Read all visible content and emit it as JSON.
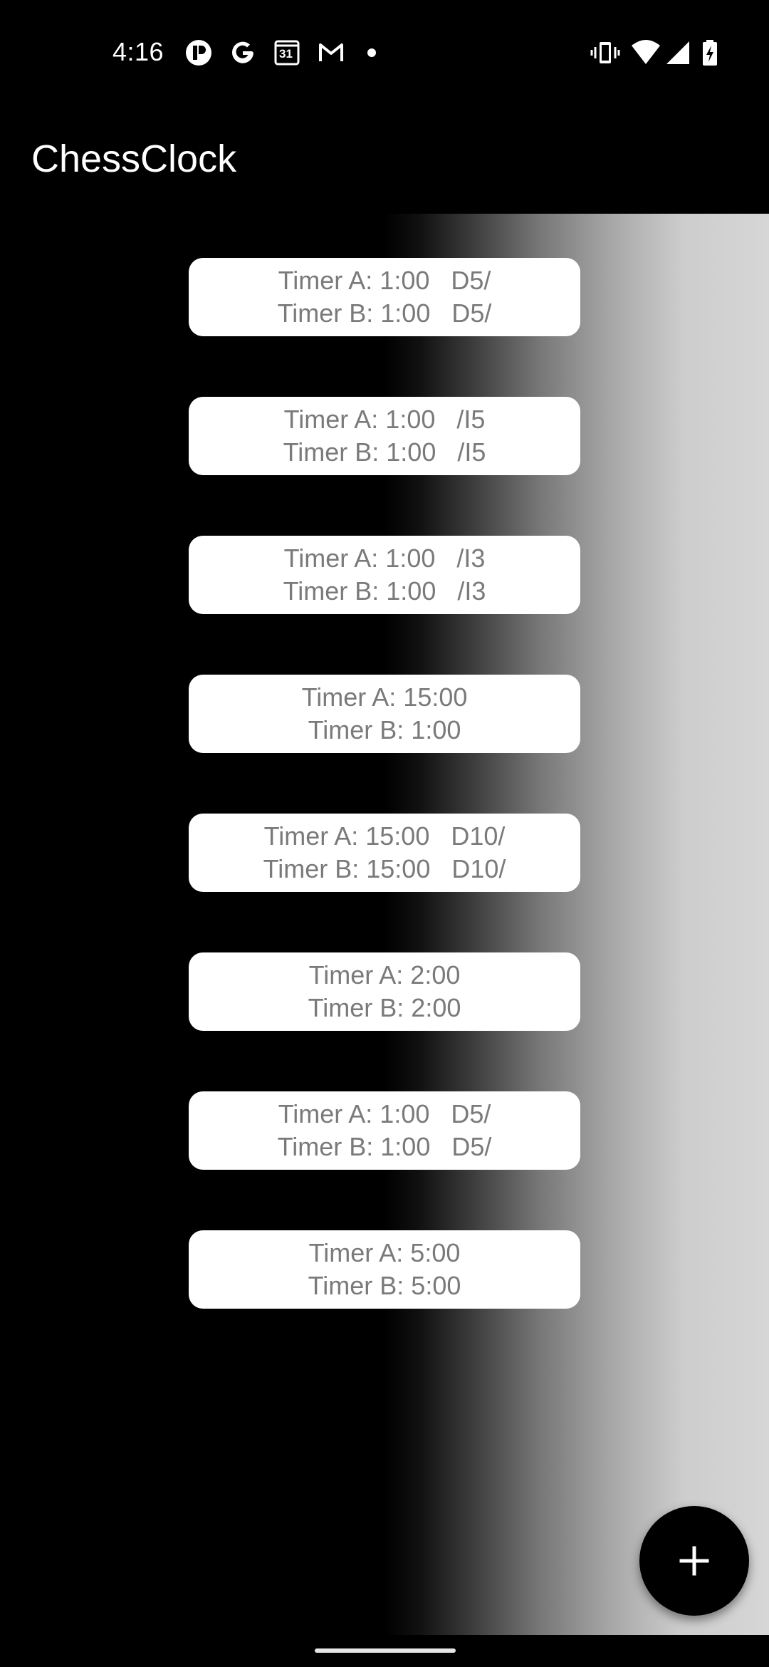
{
  "status_bar": {
    "time": "4:16",
    "calendar_day": "31",
    "left_icons": [
      "app-notification-icon",
      "google-icon",
      "calendar-icon",
      "gmail-icon",
      "dot-icon"
    ],
    "right_icons": [
      "vibrate-icon",
      "wifi-icon",
      "cellular-signal-icon",
      "battery-charging-icon"
    ]
  },
  "app_bar": {
    "title": "ChessClock"
  },
  "timers": [
    {
      "line_a": "Timer A: 1:00   D5/",
      "line_b": "Timer B: 1:00   D5/"
    },
    {
      "line_a": "Timer A: 1:00   /I5",
      "line_b": "Timer B: 1:00   /I5"
    },
    {
      "line_a": "Timer A: 1:00   /I3",
      "line_b": "Timer B: 1:00   /I3"
    },
    {
      "line_a": "Timer A: 15:00",
      "line_b": "Timer B: 1:00"
    },
    {
      "line_a": "Timer A: 15:00   D10/",
      "line_b": "Timer B: 15:00   D10/"
    },
    {
      "line_a": "Timer A: 2:00",
      "line_b": "Timer B: 2:00"
    },
    {
      "line_a": "Timer A: 1:00   D5/",
      "line_b": "Timer B: 1:00   D5/"
    },
    {
      "line_a": "Timer A: 5:00",
      "line_b": "Timer B: 5:00"
    }
  ],
  "fab": {
    "icon": "plus-icon"
  },
  "colors": {
    "background": "#000000",
    "card": "#ffffff",
    "card_text": "#7a7a7a"
  }
}
